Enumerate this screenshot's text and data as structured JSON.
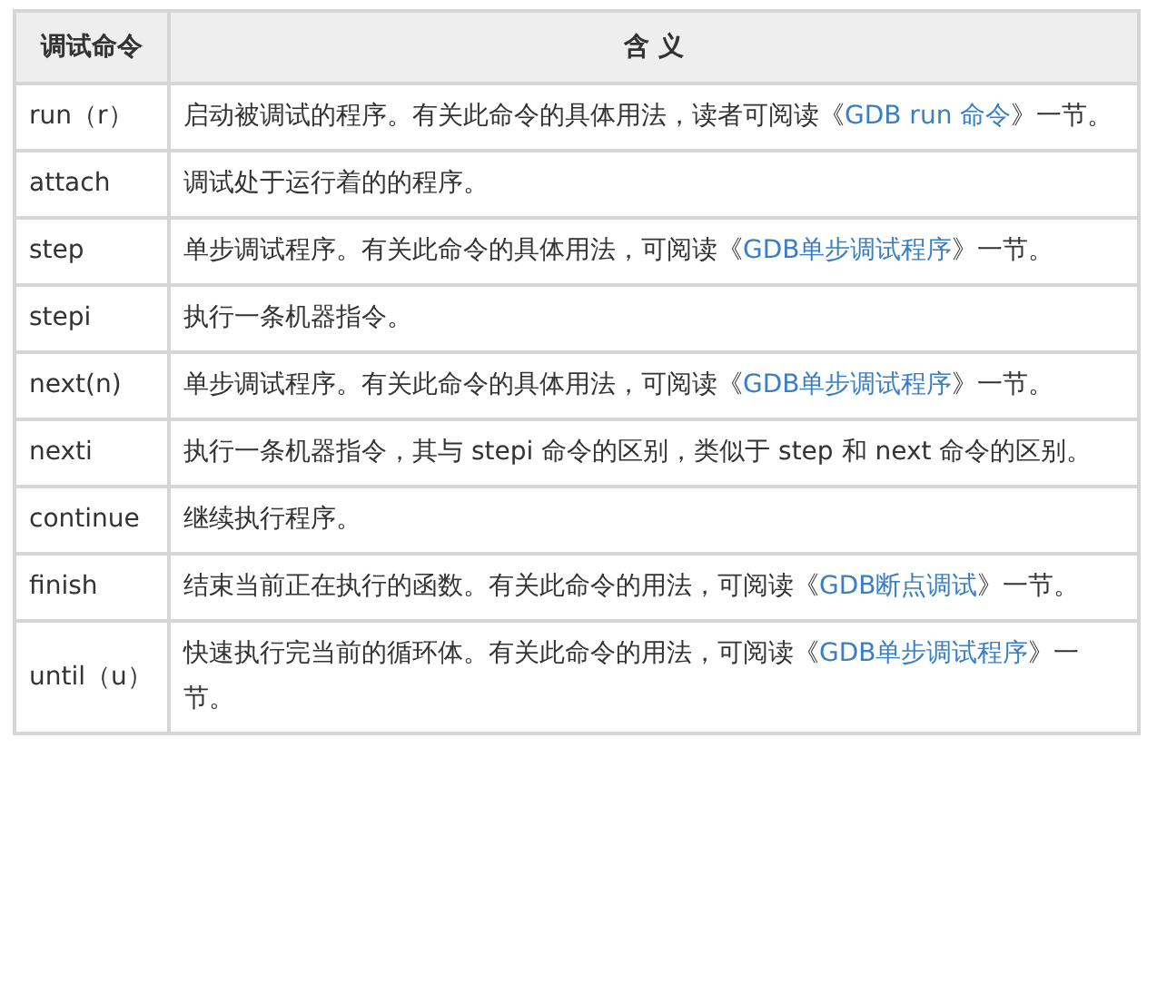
{
  "table": {
    "columns": [
      "调试命令",
      "含 义"
    ],
    "rows": [
      {
        "command": "run（r）",
        "description": {
          "before": "启动被调试的程序。有关此命令的具体用法，读者可阅读《",
          "link": "GDB run 命令",
          "after": "》一节。"
        }
      },
      {
        "command": "attach",
        "description": {
          "before": "调试处于运行着的的程序。"
        }
      },
      {
        "command": "step",
        "description": {
          "before": "单步调试程序。有关此命令的具体用法，可阅读《",
          "link": "GDB单步调试程序",
          "after": "》一节。"
        }
      },
      {
        "command": "stepi",
        "description": {
          "before": "执行一条机器指令。"
        }
      },
      {
        "command": "next(n)",
        "description": {
          "before": "单步调试程序。有关此命令的具体用法，可阅读《",
          "link": "GDB单步调试程序",
          "after": "》一节。"
        }
      },
      {
        "command": "nexti",
        "description": {
          "before": "执行一条机器指令，其与 stepi 命令的区别，类似于 step 和 next 命令的区别。"
        }
      },
      {
        "command": "continue",
        "description": {
          "before": "继续执行程序。"
        }
      },
      {
        "command": "finish",
        "description": {
          "before": "结束当前正在执行的函数。有关此命令的用法，可阅读《",
          "link": "GDB断点调试",
          "after": "》一节。"
        }
      },
      {
        "command": "until（u）",
        "description": {
          "before": "快速执行完当前的循环体。有关此命令的用法，可阅读《",
          "link": "GDB单步调试程序",
          "after": "》一节。"
        }
      }
    ]
  }
}
